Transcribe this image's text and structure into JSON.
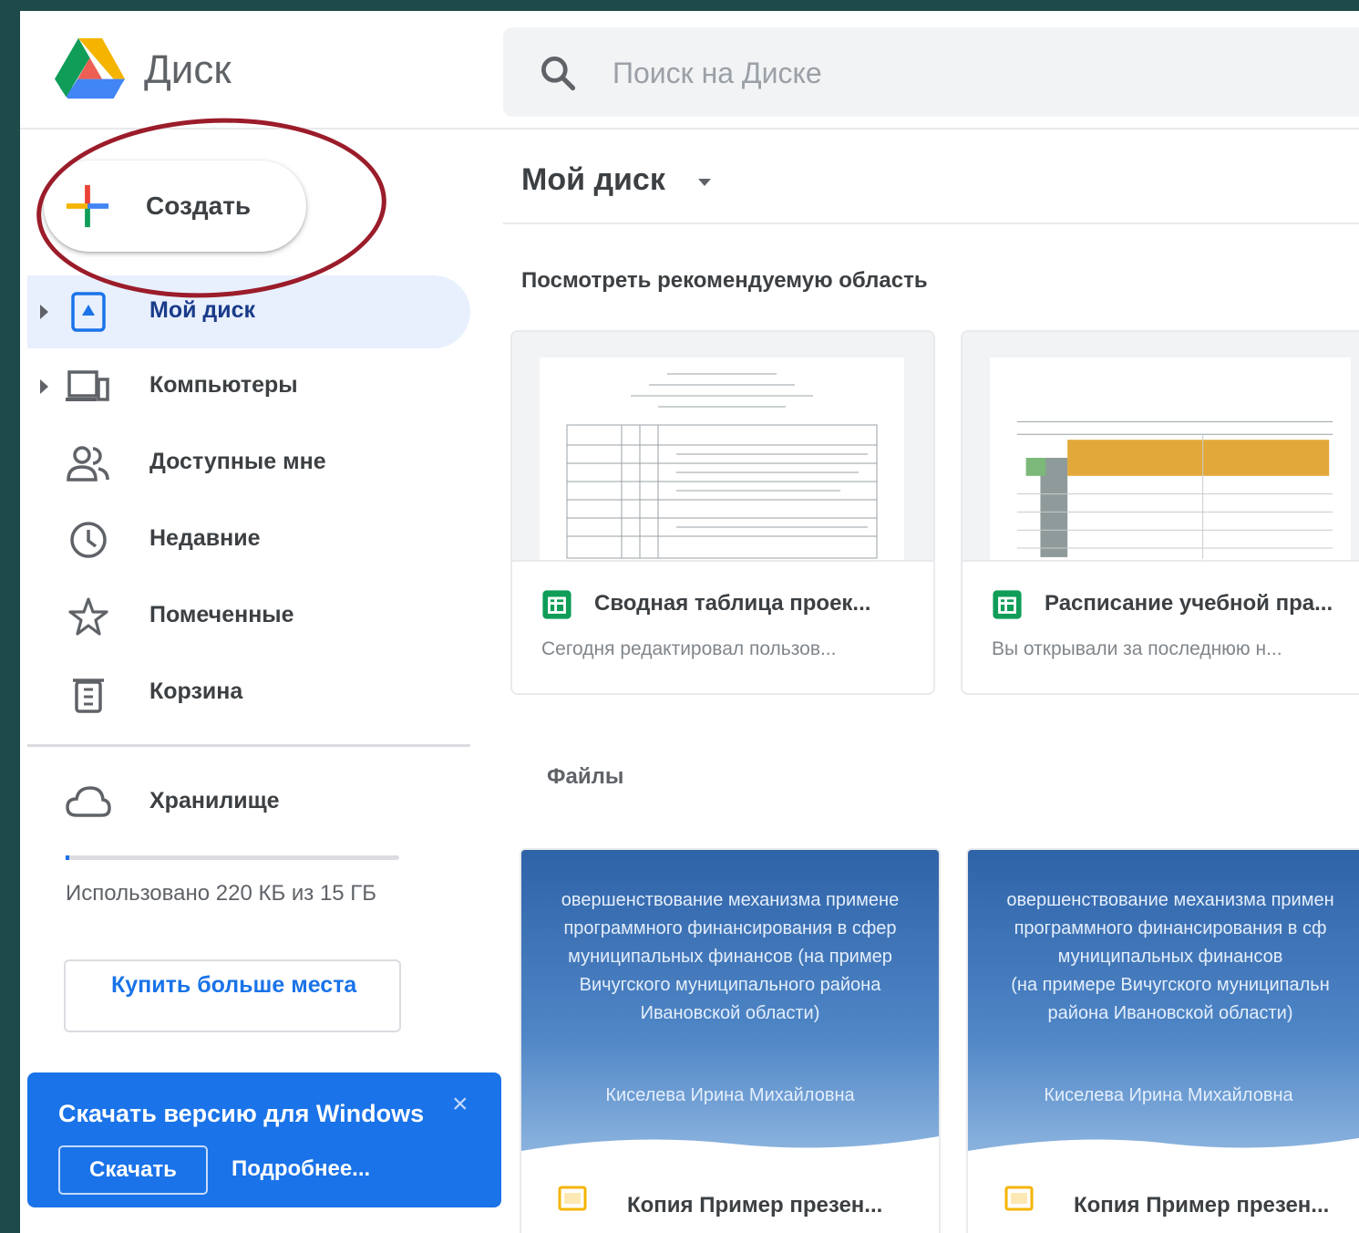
{
  "app": {
    "title": "Диск"
  },
  "search": {
    "placeholder": "Поиск на Диске"
  },
  "sidebar": {
    "create_label": "Создать",
    "items": [
      {
        "label": "Мой диск",
        "icon": "my-drive-icon",
        "active": true
      },
      {
        "label": "Компьютеры",
        "icon": "computers-icon"
      },
      {
        "label": "Доступные мне",
        "icon": "shared-people-icon"
      },
      {
        "label": "Недавние",
        "icon": "clock-icon"
      },
      {
        "label": "Помеченные",
        "icon": "star-icon"
      },
      {
        "label": "Корзина",
        "icon": "trash-icon"
      }
    ],
    "storage": {
      "label": "Хранилище",
      "usage_text": "Использовано 220 КБ из 15 ГБ",
      "used_fraction": 0.01,
      "buy_label": "Купить больше места"
    },
    "download_banner": {
      "title": "Скачать версию для Windows",
      "close": "×",
      "download_label": "Скачать",
      "more_label": "Подробнее..."
    }
  },
  "main": {
    "title": "Мой диск",
    "suggested_label": "Посмотреть рекомендуемую область",
    "suggested": [
      {
        "title": "Сводная таблица проек...",
        "subtitle": "Сегодня редактировал пользов..."
      },
      {
        "title": "Расписание учебной пра...",
        "subtitle": "Вы открывали за последнюю н..."
      }
    ],
    "files_label": "Файлы",
    "files": [
      {
        "preview_lines": [
          "овершенствование механизма примене",
          "программного финансирования в сфер",
          "муниципальных финансов (на пример",
          "Вичугского муниципального района",
          "Ивановской области)"
        ],
        "author": "Киселева Ирина Михайловна",
        "title": "Копия Пример презен..."
      },
      {
        "preview_lines": [
          "овершенствование механизма примен",
          "программного финансирования в сф",
          "муниципальных финансов",
          "(на примере Вичугского муниципальн",
          "района Ивановской области)"
        ],
        "author": "Киселева Ирина Михайловна",
        "title": "Копия Пример презен..."
      }
    ]
  },
  "colors": {
    "background": "#1f4a4a",
    "accent": "#1a73e8",
    "active_nav": "#e8f0fe",
    "annotation": "#9b1c2a",
    "sheets_green": "#0f9d58",
    "slides_yellow": "#f4b400"
  }
}
